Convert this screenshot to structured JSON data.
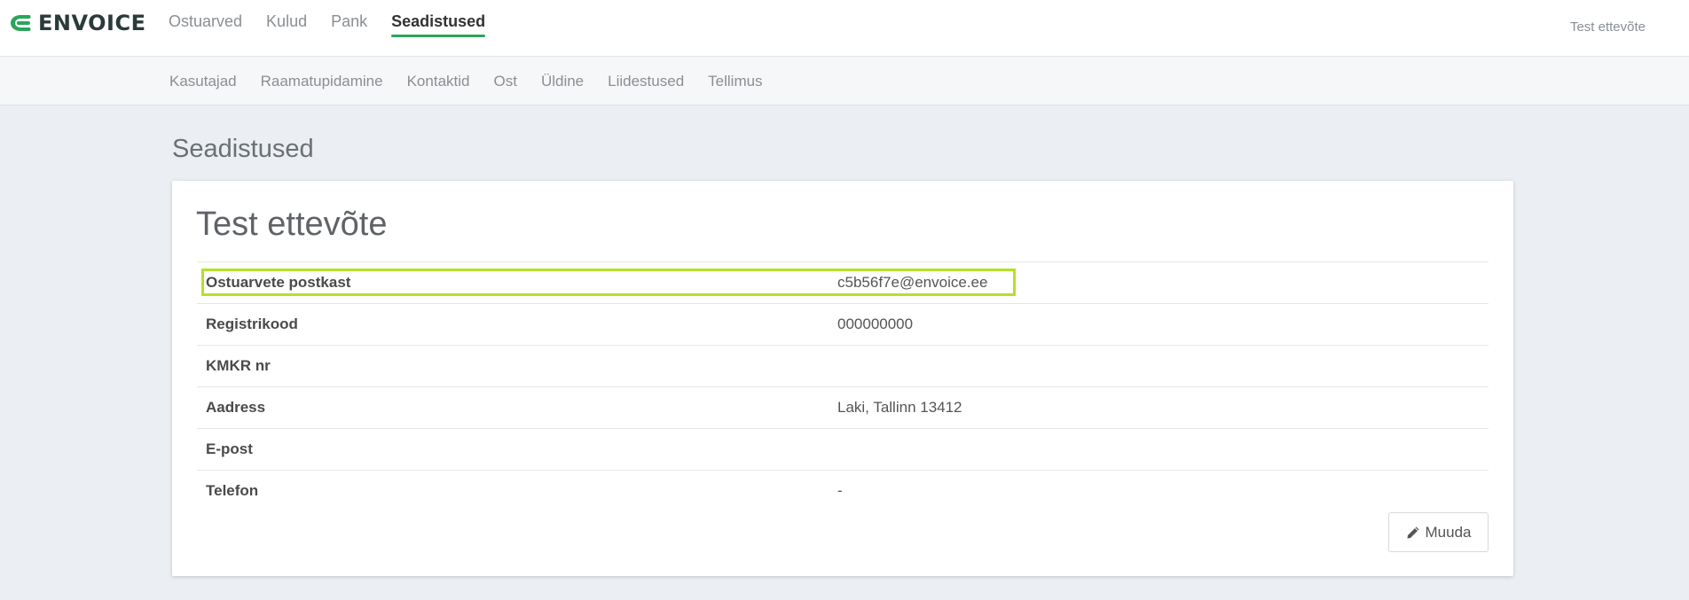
{
  "app": {
    "logo_text": "ENVOICE"
  },
  "main_nav": {
    "items": [
      {
        "label": "Ostuarved"
      },
      {
        "label": "Kulud"
      },
      {
        "label": "Pank"
      },
      {
        "label": "Seadistused",
        "active": true
      }
    ],
    "company_switch": "Test ettevõte"
  },
  "sub_nav": {
    "items": [
      {
        "label": "Kasutajad"
      },
      {
        "label": "Raamatupidamine"
      },
      {
        "label": "Kontaktid"
      },
      {
        "label": "Ost"
      },
      {
        "label": "Üldine"
      },
      {
        "label": "Liidestused"
      },
      {
        "label": "Tellimus"
      }
    ]
  },
  "page": {
    "title": "Seadistused",
    "company_name": "Test ettevõte",
    "details": [
      {
        "label": "Ostuarvete postkast",
        "value": "c5b56f7e@envoice.ee"
      },
      {
        "label": "Registrikood",
        "value": "000000000"
      },
      {
        "label": "KMKR nr",
        "value": ""
      },
      {
        "label": "Aadress",
        "value": "Laki, Tallinn 13412"
      },
      {
        "label": "E-post",
        "value": ""
      },
      {
        "label": "Telefon",
        "value": "-"
      }
    ],
    "edit_label": "Muuda"
  },
  "colors": {
    "accent": "#2aa65a",
    "highlight": "#b5e028",
    "background": "#ebeef2"
  },
  "icons": {
    "logo": "envoice-logo-icon",
    "edit": "pencil-icon"
  }
}
